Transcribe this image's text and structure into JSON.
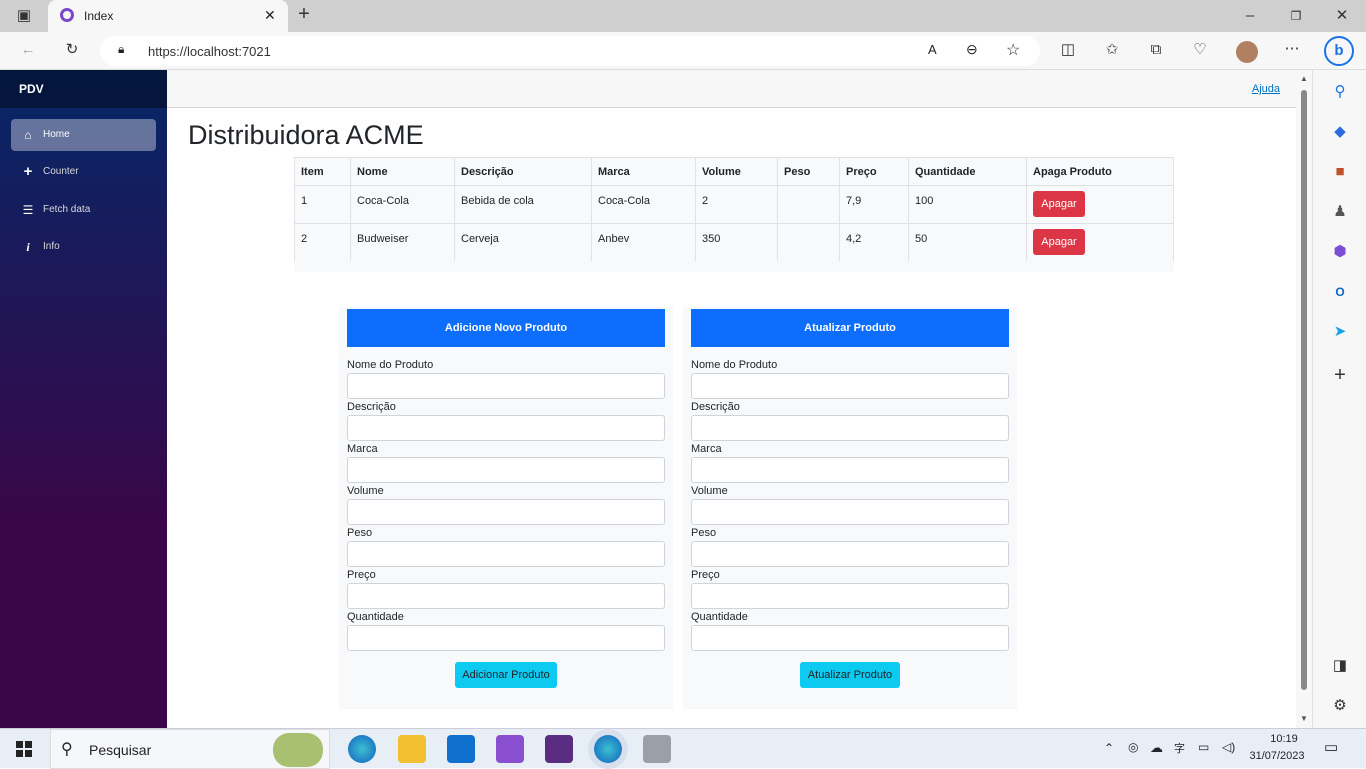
{
  "browser": {
    "tab_title": "Index",
    "url": "https://localhost:7021"
  },
  "sidebar": {
    "brand": "PDV",
    "items": [
      {
        "label": "Home",
        "icon": "home-icon"
      },
      {
        "label": "Counter",
        "icon": "plus-icon"
      },
      {
        "label": "Fetch data",
        "icon": "list-icon"
      },
      {
        "label": "Info",
        "icon": "info-icon"
      }
    ]
  },
  "header": {
    "help_link": "Ajuda"
  },
  "main": {
    "title": "Distribuidora ACME",
    "table": {
      "columns": [
        "Item",
        "Nome",
        "Descrição",
        "Marca",
        "Volume",
        "Peso",
        "Preço",
        "Quantidade",
        "Apaga Produto"
      ],
      "rows": [
        {
          "item": "1",
          "nome": "Coca-Cola",
          "descricao": "Bebida de cola",
          "marca": "Coca-Cola",
          "volume": "2",
          "peso": "",
          "preco": "7,9",
          "quantidade": "100"
        },
        {
          "item": "2",
          "nome": "Budweiser",
          "descricao": "Cerveja",
          "marca": "Anbev",
          "volume": "350",
          "peso": "",
          "preco": "4,2",
          "quantidade": "50"
        }
      ],
      "delete_label": "Apagar"
    },
    "add_form": {
      "header": "Adicione Novo Produto",
      "labels": [
        "Nome do Produto",
        "Descrição",
        "Marca",
        "Volume",
        "Peso",
        "Preço",
        "Quantidade"
      ],
      "submit": "Adicionar Produto"
    },
    "update_form": {
      "header": "Atualizar Produto",
      "labels": [
        "Nome do Produto",
        "Descrição",
        "Marca",
        "Volume",
        "Peso",
        "Preço",
        "Quantidade"
      ],
      "submit": "Atualizar Produto"
    }
  },
  "taskbar": {
    "search_placeholder": "Pesquisar",
    "time": "10:19",
    "date": "31/07/2023"
  },
  "colors": {
    "primary": "#0d6efd",
    "danger": "#dc3545",
    "info": "#0dcaf0",
    "sidebar_top": "#052767",
    "sidebar_bottom": "#3a0647"
  }
}
